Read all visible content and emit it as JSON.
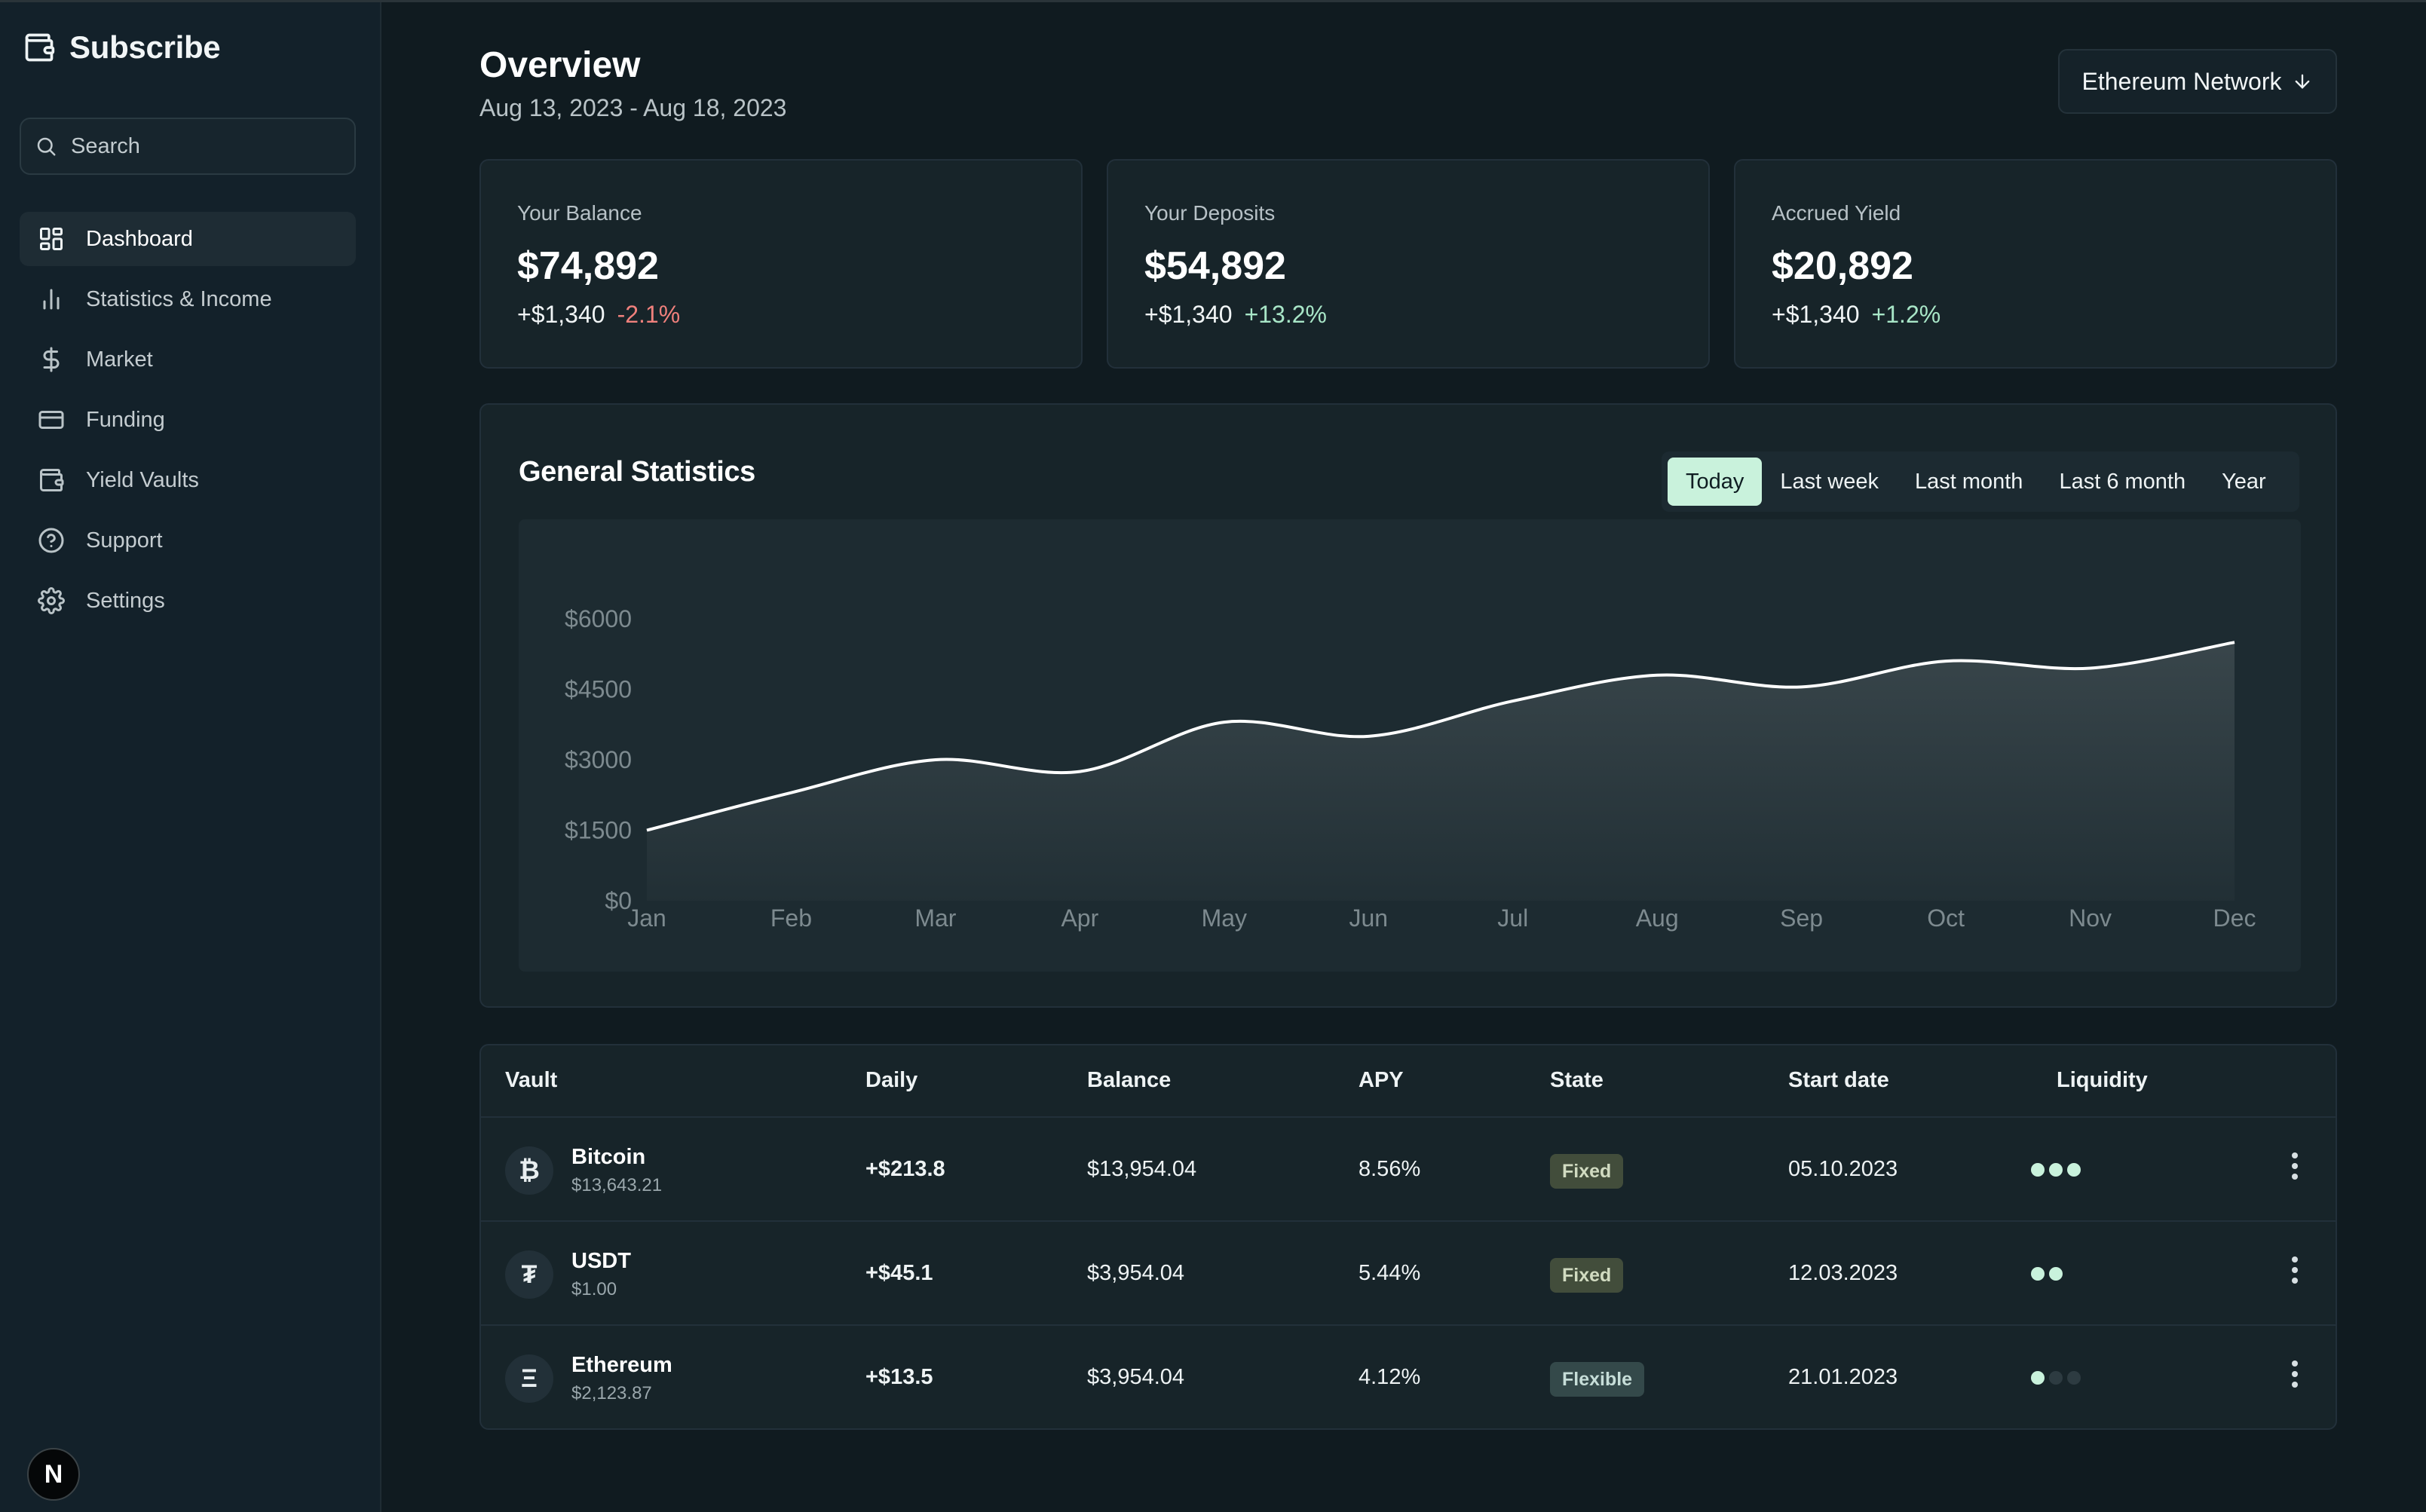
{
  "brand": {
    "title": "Subscribe",
    "icon": "wallet-icon"
  },
  "search": {
    "placeholder": "Search"
  },
  "sidebar": {
    "items": [
      {
        "label": "Dashboard",
        "icon": "dashboard-icon",
        "active": true
      },
      {
        "label": "Statistics & Income",
        "icon": "bar-chart-icon"
      },
      {
        "label": "Market",
        "icon": "dollar-icon"
      },
      {
        "label": "Funding",
        "icon": "credit-card-icon"
      },
      {
        "label": "Yield Vaults",
        "icon": "wallet-icon"
      },
      {
        "label": "Support",
        "icon": "help-circle-icon"
      },
      {
        "label": "Settings",
        "icon": "gear-icon"
      }
    ],
    "badge": "N"
  },
  "header": {
    "title": "Overview",
    "dates": "Aug 13, 2023 - Aug 18, 2023",
    "network": "Ethereum Network"
  },
  "cards": [
    {
      "label": "Your Balance",
      "value": "$74,892",
      "change": "+$1,340",
      "pct": "-2.1%"
    },
    {
      "label": "Your Deposits",
      "value": "$54,892",
      "change": "+$1,340",
      "pct": "+13.2%"
    },
    {
      "label": "Accrued Yield",
      "value": "$20,892",
      "change": "+$1,340",
      "pct": "+1.2%"
    }
  ],
  "stats": {
    "title": "General Statistics",
    "tabs": [
      "Today",
      "Last week",
      "Last month",
      "Last 6 month",
      "Year"
    ],
    "active_tab": "Today"
  },
  "chart_data": {
    "type": "area",
    "categories": [
      "Jan",
      "Feb",
      "Mar",
      "Apr",
      "May",
      "Jun",
      "Jul",
      "Aug",
      "Sep",
      "Oct",
      "Nov",
      "Dec"
    ],
    "values": [
      1500,
      2300,
      3000,
      2750,
      3800,
      3500,
      4250,
      4800,
      4550,
      5100,
      4950,
      5500
    ],
    "y_ticks": [
      "$0",
      "$1500",
      "$3000",
      "$4500",
      "$6000"
    ],
    "ylim": [
      0,
      6000
    ],
    "grid": false,
    "colors": {
      "line": "#ffffff",
      "fill": "#3a474c"
    }
  },
  "table": {
    "headers": [
      "Vault",
      "Daily",
      "Balance",
      "APY",
      "State",
      "Start date",
      "Liquidity"
    ],
    "rows": [
      {
        "icon": "bitcoin-icon",
        "symbol": "₿",
        "name": "Bitcoin",
        "price": "$13,643.21",
        "daily": "+$213.8",
        "balance": "$13,954.04",
        "apy": "8.56%",
        "state": "Fixed",
        "start": "05.10.2023",
        "liquidity": 3
      },
      {
        "icon": "tether-icon",
        "symbol": "₮",
        "name": "USDT",
        "price": "$1.00",
        "daily": "+$45.1",
        "balance": "$3,954.04",
        "apy": "5.44%",
        "state": "Fixed",
        "start": "12.03.2023",
        "liquidity": 2
      },
      {
        "icon": "ethereum-icon",
        "symbol": "Ξ",
        "name": "Ethereum",
        "price": "$2,123.87",
        "daily": "+$13.5",
        "balance": "$3,954.04",
        "apy": "4.12%",
        "state": "Flexible",
        "start": "21.01.2023",
        "liquidity": 1
      }
    ]
  },
  "colors": {
    "accent": "#c9f2dc",
    "positive": "#a8e6c7",
    "negative": "#f0807c",
    "background": "#101b20"
  }
}
